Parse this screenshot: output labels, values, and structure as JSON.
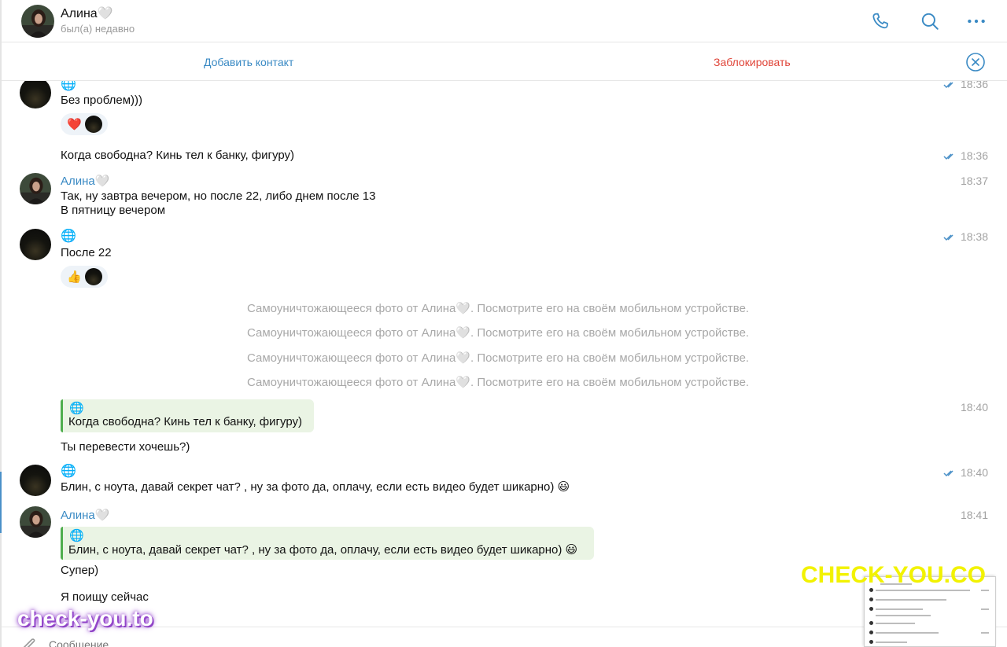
{
  "header": {
    "name": "Алина🤍",
    "status": "был(а) недавно",
    "icons": [
      "phone-icon",
      "search-icon",
      "more-icon"
    ]
  },
  "actionbar": {
    "add_contact": "Добавить контакт",
    "block": "Заблокировать"
  },
  "messages": [
    {
      "text": "Без проблем)))",
      "time": "18:36",
      "read": true,
      "reactions": [
        "heart"
      ]
    },
    {
      "text": "Когда свободна? Кинь тел к банку, фигуру)",
      "time": "18:36",
      "read": true
    },
    {
      "sender": "Алина🤍",
      "line1": "Так, ну завтра вечером, но после 22, либо днем после 13",
      "line2": "В пятницу вечером",
      "time": "18:37"
    },
    {
      "text": "После 22",
      "time": "18:38",
      "read": true,
      "reactions": [
        "thumbs-up"
      ]
    },
    {
      "reply_quote": "Когда свободна? Кинь тел к банку, фигуру)",
      "text": "Ты перевести хочешь?)",
      "time": "18:40"
    },
    {
      "text": "Блин, с ноута, давай секрет чат? , ну за фото да, оплачу, если есть видео будет шикарно) 😃",
      "time": "18:40",
      "read": true
    },
    {
      "sender": "Алина🤍",
      "reply_quote": "Блин, с ноута, давай секрет чат? , ну за фото да, оплачу, если есть видео будет шикарно) 😃",
      "text": "Супер)",
      "time": "18:41"
    },
    {
      "text": "Я поищу сейчас"
    }
  ],
  "service": [
    "Самоуничтожающееся фото от Алина🤍. Посмотрите его на своём мобильном устройстве.",
    "Самоуничтожающееся фото от Алина🤍. Посмотрите его на своём мобильном устройстве.",
    "Самоуничтожающееся фото от Алина🤍. Посмотрите его на своём мобильном устройстве.",
    "Самоуничтожающееся фото от Алина🤍. Посмотрите его на своём мобильном устройстве."
  ],
  "reactions": {
    "heart": "❤️",
    "thumbs_up": "👍"
  },
  "globe_glyph": "🌐",
  "watermarks": {
    "top": "CHECK-YOU.CO",
    "bottom": "check-you.to"
  },
  "composer": {
    "placeholder": "Сообщение"
  },
  "colors": {
    "accent": "#3a8ac4",
    "block": "#e0463a",
    "quote_bar": "#4fae4e",
    "quote_bg": "#eaf4e4",
    "read_check": "#4a90c8"
  }
}
